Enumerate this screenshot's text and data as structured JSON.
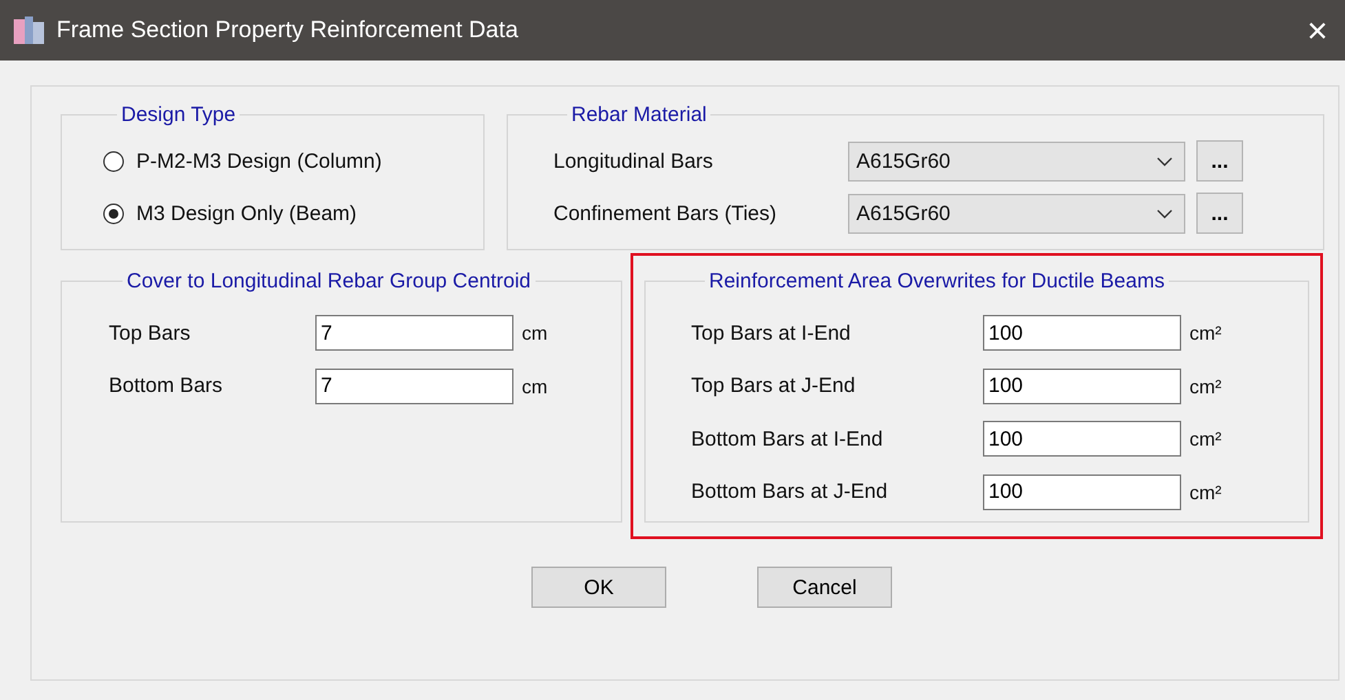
{
  "window": {
    "title": "Frame Section Property Reinforcement Data",
    "close": "×"
  },
  "design_type": {
    "title": "Design Type",
    "options": [
      {
        "label": "P-M2-M3 Design  (Column)",
        "selected": false
      },
      {
        "label": "M3 Design Only  (Beam)",
        "selected": true
      }
    ]
  },
  "rebar_material": {
    "title": "Rebar Material",
    "rows": [
      {
        "label": "Longitudinal Bars",
        "value": "A615Gr60",
        "button": "..."
      },
      {
        "label": "Confinement Bars (Ties)",
        "value": "A615Gr60",
        "button": "..."
      }
    ]
  },
  "cover": {
    "title": "Cover to Longitudinal Rebar Group Centroid",
    "rows": [
      {
        "label": "Top Bars",
        "value": "7",
        "unit": "cm"
      },
      {
        "label": "Bottom  Bars",
        "value": "7",
        "unit": "cm"
      }
    ]
  },
  "overwrites": {
    "title": "Reinforcement Area Overwrites for Ductile Beams",
    "highlighted": true,
    "rows": [
      {
        "label": "Top Bars at I-End",
        "value": "100",
        "unit": "cm²"
      },
      {
        "label": "Top Bars at J-End",
        "value": "100",
        "unit": "cm²"
      },
      {
        "label": "Bottom Bars at I-End",
        "value": "100",
        "unit": "cm²"
      },
      {
        "label": "Bottom Bars at J-End",
        "value": "100",
        "unit": "cm²"
      }
    ]
  },
  "buttons": [
    "OK",
    "Cancel"
  ]
}
